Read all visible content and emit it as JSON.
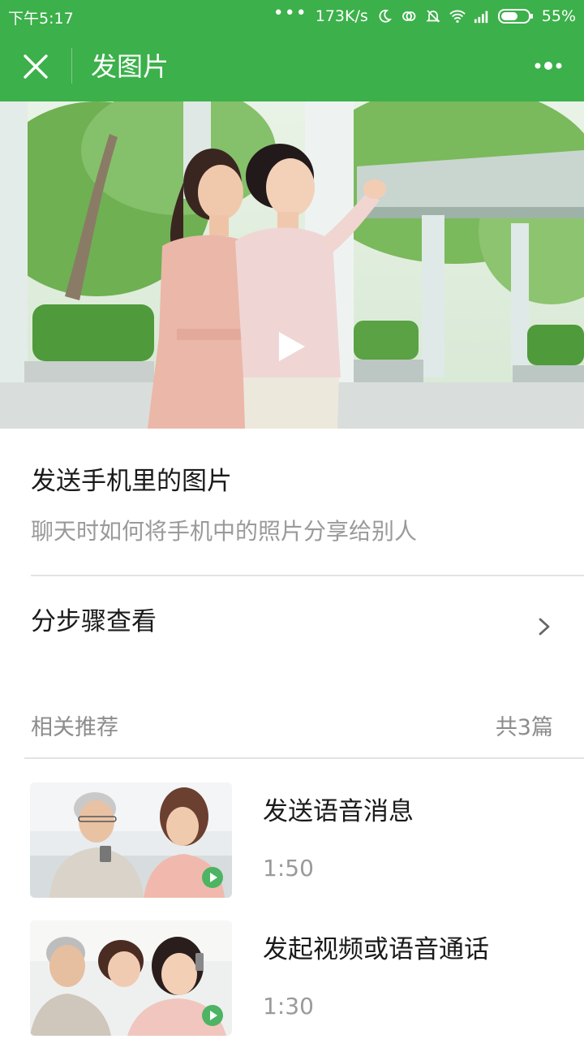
{
  "status_bar": {
    "time": "下午5:17",
    "network_speed": "173K/s",
    "battery": "55%",
    "icons": [
      "more-dots-icon",
      "moon-icon",
      "sync-icon",
      "mute-bell-icon",
      "wifi-icon",
      "signal-icon",
      "battery-icon"
    ]
  },
  "nav": {
    "title": "发图片",
    "close_icon": "close-icon",
    "more_icon": "more-icon"
  },
  "hero": {
    "play_icon": "play-icon"
  },
  "article": {
    "title": "发送手机里的图片",
    "subtitle": "聊天时如何将手机中的照片分享给别人"
  },
  "steps": {
    "label": "分步骤查看",
    "chevron_icon": "chevron-right-icon"
  },
  "related": {
    "label": "相关推荐",
    "count": "共3篇",
    "items": [
      {
        "title": "发送语音消息",
        "duration": "1:50"
      },
      {
        "title": "发起视频或语音通话",
        "duration": "1:30"
      }
    ]
  },
  "colors": {
    "brand_green": "#3cb04a",
    "play_badge_green": "#4cb462",
    "text_primary": "#1a1a1a",
    "text_secondary": "#9a9a9a"
  }
}
